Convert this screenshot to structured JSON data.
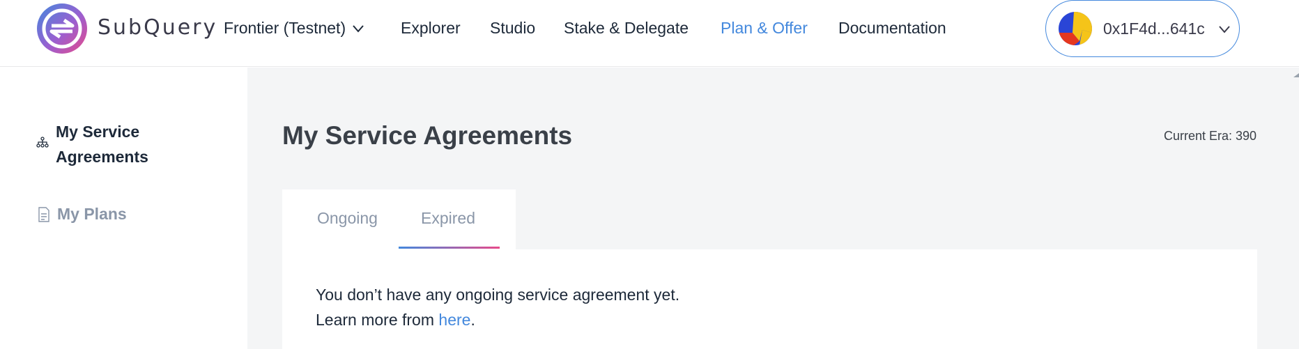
{
  "header": {
    "logo_text": "SubQuery",
    "network": "Frontier (Testnet)",
    "nav": [
      "Explorer",
      "Studio",
      "Stake & Delegate",
      "Plan & Offer",
      "Documentation"
    ],
    "active_nav": "Plan & Offer",
    "account": "0x1F4d...641c"
  },
  "sidebar": {
    "items": [
      {
        "label": "My Service Agreements",
        "icon": "network-icon",
        "active": true
      },
      {
        "label": "My Plans",
        "icon": "document-icon",
        "active": false
      }
    ]
  },
  "main": {
    "title": "My Service Agreements",
    "era": "Current Era: 390",
    "tabs": [
      {
        "label": "Ongoing",
        "selected": false
      },
      {
        "label": "Expired",
        "selected": true
      }
    ],
    "empty_message": "You don’t have any ongoing service agreement yet.",
    "learn_more_prefix": "Learn more from ",
    "learn_more_link": "here",
    "learn_more_suffix": "."
  },
  "colors": {
    "accent": "#4388dd",
    "gradient_end": "#e74a8a",
    "main_bg": "#f4f5f6",
    "text": "#1d2939",
    "muted": "#8a96a8"
  }
}
